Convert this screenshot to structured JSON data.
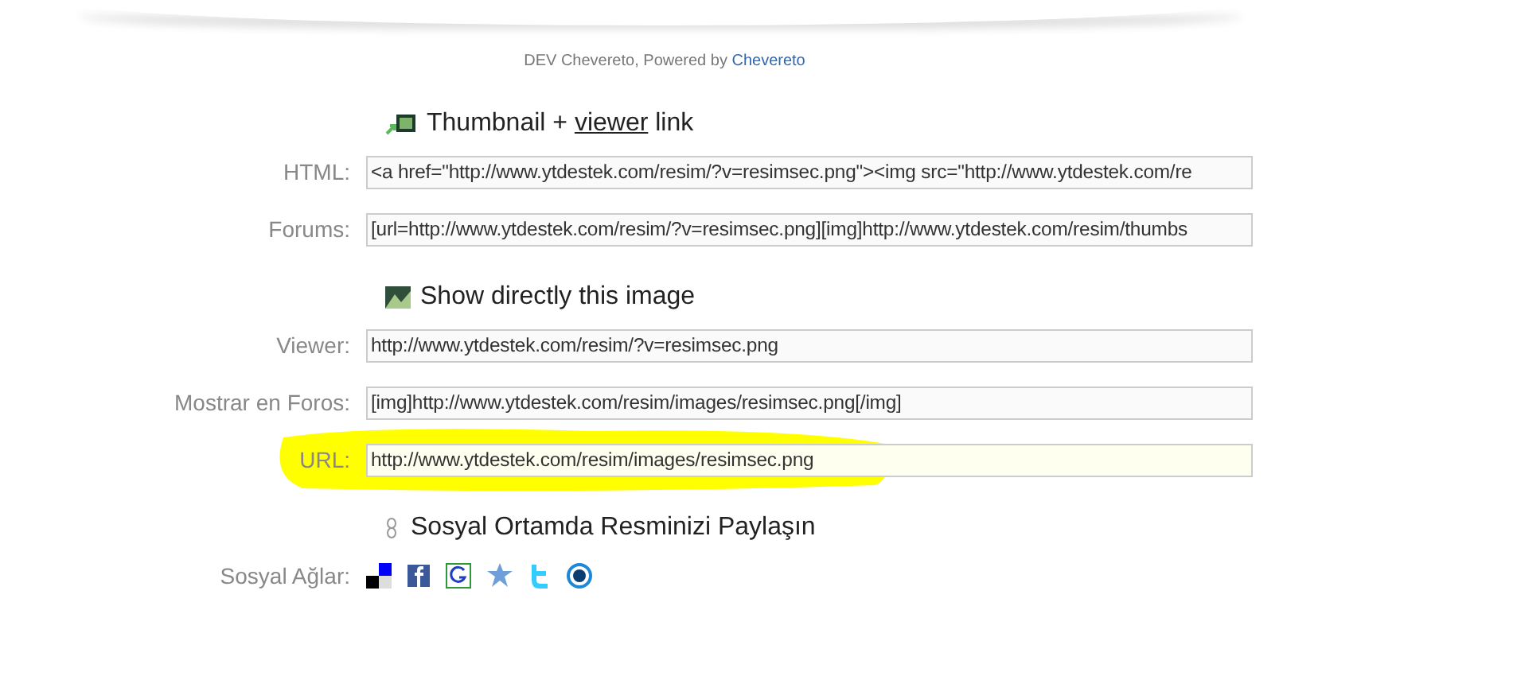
{
  "footer": {
    "text": "DEV Chevereto, Powered by",
    "link": "Chevereto"
  },
  "sections": [
    {
      "kind": "thumb",
      "title_before": "Thumbnail + ",
      "title_link": "viewer",
      "title_after": " link",
      "fields": [
        {
          "label": "HTML:",
          "value": "<a href=\"http://www.ytdestek.com/resim/?v=resimsec.png\"><img src=\"http://www.ytdestek.com/re",
          "highlighted": false
        },
        {
          "label": "Forums:",
          "value": "[url=http://www.ytdestek.com/resim/?v=resimsec.png][img]http://www.ytdestek.com/resim/thumbs",
          "highlighted": false
        }
      ]
    },
    {
      "kind": "image",
      "title_before": "Show directly this image",
      "fields": [
        {
          "label": "Viewer:",
          "value": "http://www.ytdestek.com/resim/?v=resimsec.png",
          "highlighted": false
        },
        {
          "label": "Mostrar en Foros:",
          "value": "[img]http://www.ytdestek.com/resim/images/resimsec.png[/img]",
          "highlighted": false
        },
        {
          "label": "URL:",
          "value": "http://www.ytdestek.com/resim/images/resimsec.png",
          "highlighted": true
        }
      ]
    },
    {
      "kind": "share",
      "title_before": "Sosyal Ortamda Resminizi Paylaşın",
      "social_label": "Sosyal Ağlar:"
    }
  ]
}
